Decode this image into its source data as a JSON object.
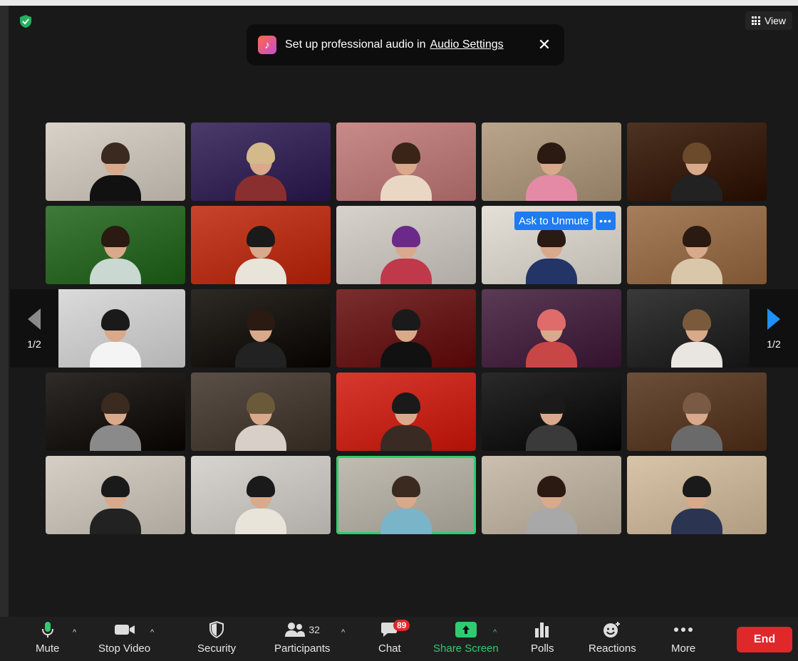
{
  "banner": {
    "text": "Set up professional audio in",
    "link": "Audio Settings",
    "close": "✕"
  },
  "view_button": {
    "label": "View"
  },
  "ask_to_unmute": {
    "label": "Ask to Unmute",
    "more": "•••"
  },
  "pager": {
    "left": "1/2",
    "right": "1/2"
  },
  "toolbar": {
    "mute": "Mute",
    "stop_video": "Stop Video",
    "security": "Security",
    "participants": "Participants",
    "participants_count": "32",
    "chat": "Chat",
    "chat_badge": "89",
    "share_screen": "Share Screen",
    "polls": "Polls",
    "reactions": "Reactions",
    "more": "More",
    "end": "End"
  },
  "colors": {
    "accent_blue": "#1e7bf2",
    "share_green": "#2ecc71",
    "end_red": "#e0272a",
    "active_speaker": "#2ecc71"
  }
}
